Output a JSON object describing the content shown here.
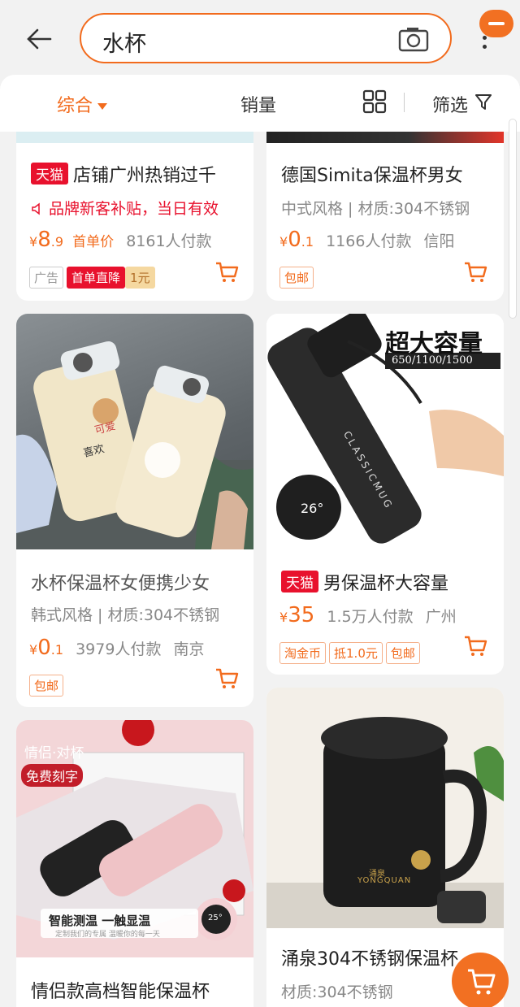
{
  "search": {
    "query": "水杯"
  },
  "filters": {
    "comprehensive": "综合",
    "sales": "销量",
    "filter": "筛选"
  },
  "products": [
    {
      "tag": "天猫",
      "title": "店铺广州热销过千",
      "promo": "品牌新客补贴，当日有效",
      "price_symbol": "¥",
      "price_int": "8",
      "price_dec": ".9",
      "first_price_label": "首单价",
      "sales": "8161人付款",
      "chips": [
        "广告",
        "首单直降",
        "1元"
      ]
    },
    {
      "title": "德国Simita保温杯男女",
      "attrs": "中式风格 | 材质:304不锈钢",
      "price_symbol": "¥",
      "price_int": "0",
      "price_dec": ".1",
      "sales": "1166人付款",
      "location": "信阳",
      "chips": [
        "包邮"
      ]
    },
    {
      "title": "水杯保温杯女便携少女",
      "attrs": "韩式风格 | 材质:304不锈钢",
      "price_symbol": "¥",
      "price_int": "0",
      "price_dec": ".1",
      "sales": "3979人付款",
      "location": "南京",
      "chips": [
        "包邮"
      ],
      "image_text": [
        "可爱",
        "喜欢"
      ]
    },
    {
      "tag": "天猫",
      "title": "男保温杯大容量",
      "price_symbol": "¥",
      "price_int": "35",
      "sales": "1.5万人付款",
      "location": "广州",
      "chips": [
        "淘金币",
        "抵1.0元",
        "包邮"
      ],
      "image_text": {
        "headline": "超大容量",
        "sizes": "650/1100/1500",
        "brand": "CLASSICMUG",
        "temp": "26°"
      }
    },
    {
      "title": "情侣款高档智能保温杯",
      "image_text": {
        "tag1": "情侣·对杯",
        "tag2": "免费刻字",
        "banner": "智能测温 一触显温",
        "sub": "定制我们的专属 温暖你的每一天",
        "temp": "25°"
      }
    },
    {
      "title": "涌泉304不锈钢保温杯",
      "attrs": "材质:304不锈钢",
      "image_text": {
        "brand": "YONGQUAN",
        "brand_cn": "涌泉"
      }
    }
  ],
  "colors": {
    "accent": "#f26b1d",
    "tmall": "#e8112d"
  }
}
